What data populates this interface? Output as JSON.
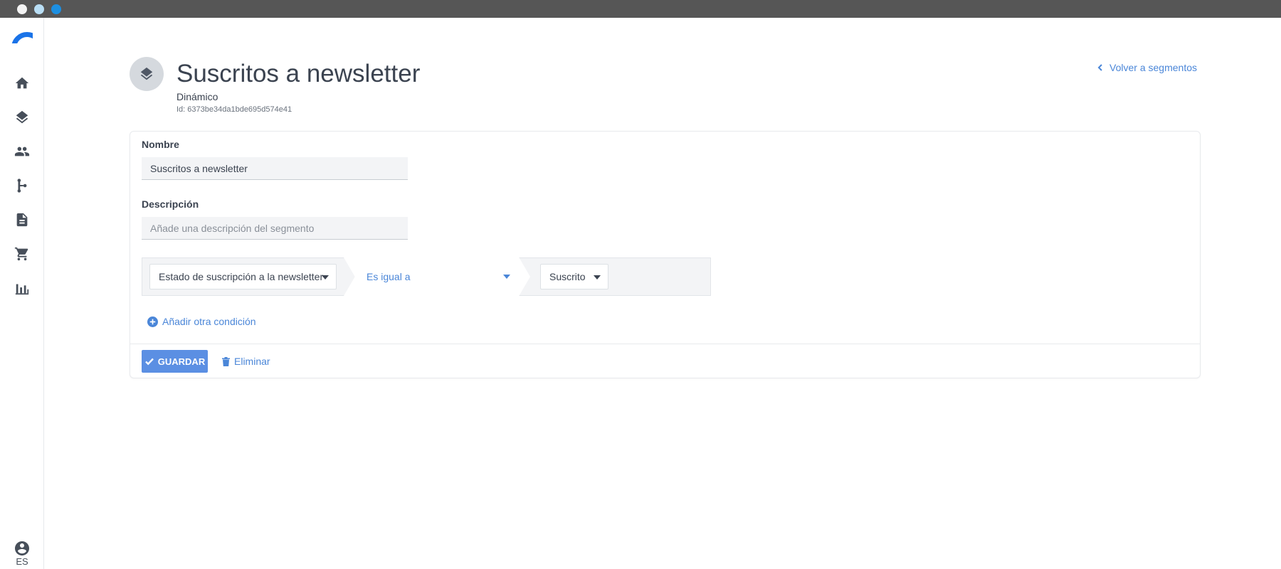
{
  "window": {
    "controls": [
      "close",
      "minimize",
      "maximize"
    ]
  },
  "sidebar": {
    "logo": "arc-logo",
    "items": [
      {
        "name": "home",
        "icon": "home-icon"
      },
      {
        "name": "segments",
        "icon": "layers-icon"
      },
      {
        "name": "contacts",
        "icon": "people-icon"
      },
      {
        "name": "flows",
        "icon": "flow-icon"
      },
      {
        "name": "content",
        "icon": "document-icon"
      },
      {
        "name": "ecommerce",
        "icon": "cart-icon"
      },
      {
        "name": "reports",
        "icon": "bar-chart-icon"
      }
    ],
    "user_icon": "account-circle-icon",
    "language": "ES"
  },
  "header": {
    "avatar_icon": "layers-icon",
    "title": "Suscritos a newsletter",
    "type": "Dinámico",
    "id_text": "Id: 6373be34da1bde695d574e41",
    "back_link": "Volver a segmentos"
  },
  "form": {
    "name_label": "Nombre",
    "name_value": "Suscritos a newsletter",
    "description_label": "Descripción",
    "description_value": "",
    "description_placeholder": "Añade una descripción del segmento",
    "condition": {
      "field": "Estado de suscripción a la newsletter",
      "operator": "Es igual a",
      "value": "Suscrito"
    },
    "add_condition_label": "Añadir otra condición",
    "save_label": "GUARDAR",
    "delete_label": "Eliminar"
  },
  "colors": {
    "accent": "#4a86d8",
    "primary_button": "#5b8fe3",
    "logo": "#1a73e8",
    "titlebar": "#565656"
  }
}
